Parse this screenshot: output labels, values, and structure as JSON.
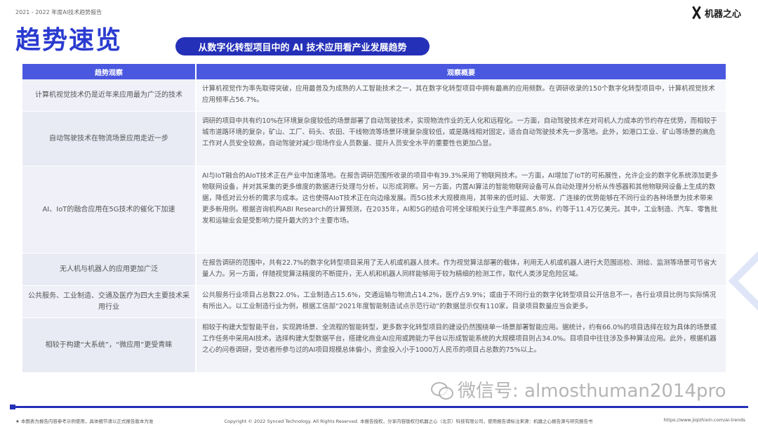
{
  "header": {
    "report_label": "2021 - 2022 年度AI技术趋势报告",
    "logo_text": "机器之心",
    "page_title": "趋势速览",
    "subtitle": "从数字化转型项目中的 AI 技术应用看产业发展趋势"
  },
  "table": {
    "headers": [
      "趋势观察",
      "观察概要"
    ],
    "rows": [
      {
        "trend": "计算机视觉技术仍是近年来应用最为广泛的技术",
        "desc": "计算机视觉作为率先取得突破，应用最普及为成熟的人工智能技术之一，其在数字化转型项目中拥有最高的应用频数。在调研收录的150个数字化转型项目中，计算机视觉技术应用频率占56.7%。"
      },
      {
        "trend": "自动驾驶技术在物流场景应用走近一步",
        "desc": "调研的项目中共有约10%在环境复杂度较低的场景部署了自动驾驶技术，实现物流作业的无人化和远程化。一方面，自动驾驶技术在对司机人力成本的节约存在优势，而相较于城市道路环境的复杂，矿山、工厂、码头、农田、干线物流等场景环境复杂度较低，或是路线相对固定，适合自动驾驶技术先一步落地。此外，如港口工业、矿山等场景的高危工作对人员安全较高，自动驾驶对减少现场作业人员数量、提升人员安全水平的重要性也更加凸显。"
      },
      {
        "trend": "AI、IoT的融合应用在5G技术的催化下加速",
        "desc": "AI与IoT融合的AIoT技术正在产业中加速落地。在报告调研范围所收录的项目中有39.3%采用了物联网技术。一方面，AI增加了IoT的可拓展性，允许企业的数字化系统添加更多物联网设备，并对其采集的更多维度的数据进行处理与分析，以形成洞察。另一方面，内置AI算法的智能物联网设备可从自动处理并分析从传感器和其他物联网设备上生成的数据，降低对云分析的需求与成本。这也使得AIoT技术正在向边缘发展。而5G技术大规模商用，其带来的低时延、大带宽、广连接的优势能够在不同行业的各种场景为技术带来更多新用例。根据咨询机构ABI Research的计算预测，在2035年，AI和5G的结合可将全球相关行业生产率提高5.8%，约等于11.4万亿美元。其中，工业制造、汽车、零售批发和运输业会是受影响力提升最大的3个主要市场。"
      },
      {
        "trend": "无人机与机器人的应用更加广泛",
        "desc": "在报告调研的范围中，共有22.7%的数字化转型项目采用了无人机或机器人技术。作为视觉算法部署的载体，利用无人机或机器人进行大范围巡检、测绘、监测等场景可节省大量人力。另一方面，伴随视觉算法精度的不断提升，无人机和机器人同样能够用于较为精细的检测工作，取代人类涉足危险区域。"
      },
      {
        "trend": "公共服务、工业制造、交通及医疗为四大主要技术采用行业",
        "desc": "公共服务行业项目占总数22.0%，工业制造占15.6%，交通运输与物流占14.2%，医疗占9.9%；或由于不同行业的数字化转型项目公开信息不一，各行业项目比例与实际情况有所出入。以工业制造行业为例，根据工信部“2021年度智能制造试点示范行动”的数据显示仅有110家，目录项目数量应当会更多。"
      },
      {
        "trend": "相较于构建“大系统”，“微应用”更受青睐",
        "desc": "相较于构建大型智能平台，实现跨场景、全流程的智能转型，更多数字化转型项目的建设仍然围绕单一场景部署智能应用。据统计，约有66.0%的项目选择在较为具体的场景或工作任务中采用AI技术。选择构建大型数据平台，搭建化商业AI应用或跨能力平台以形成智能系统的大规模项目则占34.0%。目项目中往往涉及多种算法应用。此外，根据机器之心的问卷调研，受访者所参与过的AI项目规模总体偏小，资金投入小于1000万人民币的项目占总数的75%以上。"
      }
    ]
  },
  "watermark": {
    "text": "微信号: almosthuman2014pro"
  },
  "footer": {
    "left": "★ 本图表为报告内容参考示例使用，具体细节请以正式报告版本为准",
    "center": "Copyright © 2022 Synced Technology. All Rights Reserved.   本报告授权，分享内容版权归机器之心（北京）科技有限公司，使用报告请标注来源：机器之心报告源与研究报告书",
    "right": "https://www.jiqizhixin.com/ai-trends"
  }
}
